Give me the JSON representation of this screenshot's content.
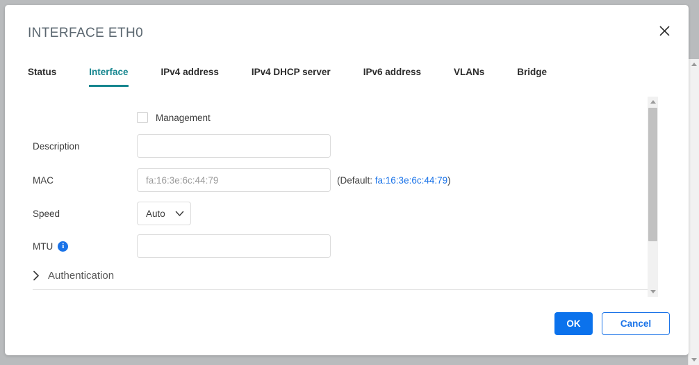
{
  "dialog": {
    "title": "INTERFACE ETH0",
    "close_icon": "close-icon"
  },
  "tabs": [
    {
      "label": "Status",
      "active": false
    },
    {
      "label": "Interface",
      "active": true
    },
    {
      "label": "IPv4 address",
      "active": false
    },
    {
      "label": "IPv4 DHCP server",
      "active": false
    },
    {
      "label": "IPv6 address",
      "active": false
    },
    {
      "label": "VLANs",
      "active": false
    },
    {
      "label": "Bridge",
      "active": false
    }
  ],
  "form": {
    "management": {
      "label": "Management",
      "checked": false
    },
    "description": {
      "label": "Description",
      "value": "",
      "placeholder": ""
    },
    "mac": {
      "label": "MAC",
      "value": "",
      "placeholder": "fa:16:3e:6c:44:79",
      "hint_prefix": "(Default: ",
      "hint_link": "fa:16:3e:6c:44:79",
      "hint_suffix": ")"
    },
    "speed": {
      "label": "Speed",
      "value": "Auto",
      "options": [
        "Auto"
      ],
      "chevron_icon": "chevron-down-icon"
    },
    "mtu": {
      "label": "MTU",
      "value": "",
      "placeholder": "",
      "info_icon": "info-icon",
      "info_glyph": "i"
    },
    "authentication": {
      "label": "Authentication",
      "expanded": false,
      "chevron_icon": "chevron-right-icon"
    }
  },
  "footer": {
    "ok_label": "OK",
    "cancel_label": "Cancel"
  },
  "colors": {
    "accent_teal": "#16868f",
    "link_blue": "#1a73e8",
    "primary_blue": "#0b72ec",
    "title_gray": "#5b6770",
    "backdrop": "#b9bbbd"
  },
  "scrollbars": {
    "content": {
      "up_icon": "caret-up-icon",
      "down_icon": "caret-down-icon"
    },
    "page": {
      "up_icon": "caret-up-icon",
      "down_icon": "caret-down-icon"
    }
  }
}
